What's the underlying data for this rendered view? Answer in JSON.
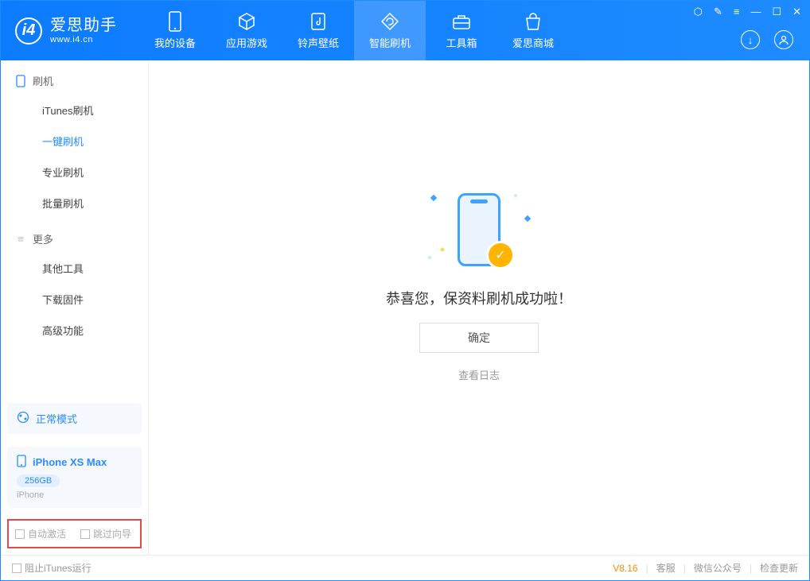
{
  "app": {
    "name_cn": "爱思助手",
    "name_en": "www.i4.cn"
  },
  "nav": {
    "items": [
      {
        "label": "我的设备",
        "icon": "device-icon"
      },
      {
        "label": "应用游戏",
        "icon": "cube-icon"
      },
      {
        "label": "铃声壁纸",
        "icon": "music-icon"
      },
      {
        "label": "智能刷机",
        "icon": "refresh-icon"
      },
      {
        "label": "工具箱",
        "icon": "toolbox-icon"
      },
      {
        "label": "爱思商城",
        "icon": "bag-icon"
      }
    ],
    "active_index": 3
  },
  "sidebar": {
    "group1": {
      "title": "刷机",
      "items": [
        "iTunes刷机",
        "一键刷机",
        "专业刷机",
        "批量刷机"
      ],
      "active_index": 1
    },
    "group2": {
      "title": "更多",
      "items": [
        "其他工具",
        "下载固件",
        "高级功能"
      ]
    }
  },
  "device": {
    "mode": "正常模式",
    "name": "iPhone XS Max",
    "capacity": "256GB",
    "type": "iPhone"
  },
  "options": {
    "auto_activate": "自动激活",
    "skip_guide": "跳过向导"
  },
  "main": {
    "success_text": "恭喜您，保资料刷机成功啦！",
    "ok_label": "确定",
    "log_link": "查看日志"
  },
  "footer": {
    "block_itunes": "阻止iTunes运行",
    "version": "V8.16",
    "links": [
      "客服",
      "微信公众号",
      "检查更新"
    ]
  }
}
